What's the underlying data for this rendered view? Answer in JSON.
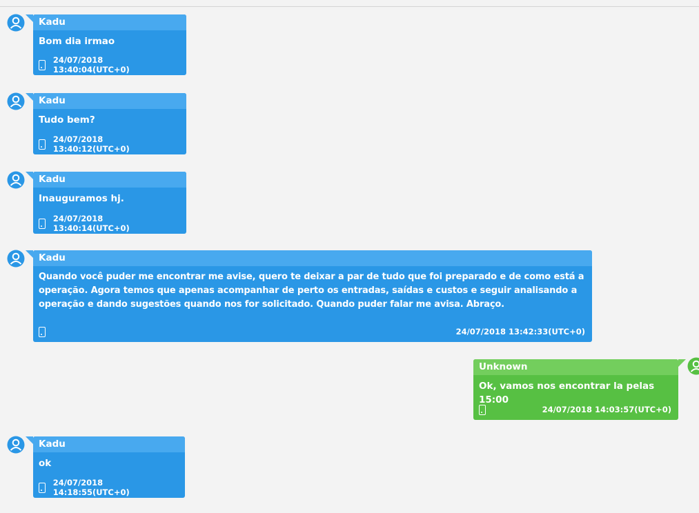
{
  "colors": {
    "incoming": "#2a97e6",
    "incoming_header": "#48a9ef",
    "outgoing": "#57c043",
    "outgoing_header": "#73ce5d",
    "avatar": "#2a97e6"
  },
  "messages": [
    {
      "sender": "Kadu",
      "text": "Bom dia irmao",
      "timestamp": "24/07/2018 13:40:04(UTC+0)",
      "direction": "incoming",
      "icon": "phone-icon"
    },
    {
      "sender": "Kadu",
      "text": "Tudo bem?",
      "timestamp": "24/07/2018 13:40:12(UTC+0)",
      "direction": "incoming",
      "icon": "phone-icon"
    },
    {
      "sender": "Kadu",
      "text": "Inauguramos hj.",
      "timestamp": "24/07/2018 13:40:14(UTC+0)",
      "direction": "incoming",
      "icon": "phone-icon"
    },
    {
      "sender": "Kadu",
      "text_lines": [
        "Quando você puder me encontrar me avise, quero te deixar a par de tudo que foi preparado e de como está a",
        "operação.  Agora temos que apenas acompanhar de perto os entradas, saídas e custos e seguir analisando a",
        "operação e dando sugestões quando nos for solicitado. Quando puder falar me avisa. Abraço."
      ],
      "timestamp": "24/07/2018 13:42:33(UTC+0)",
      "direction": "incoming",
      "icon": "phone-icon"
    },
    {
      "sender": "Unknown",
      "text": "Ok, vamos nos encontrar la pelas 15:00",
      "timestamp": "24/07/2018 14:03:57(UTC+0)",
      "direction": "outgoing",
      "icon": "phone-icon"
    },
    {
      "sender": "Kadu",
      "text": "ok",
      "timestamp": "24/07/2018 14:18:55(UTC+0)",
      "direction": "incoming",
      "icon": "phone-icon"
    }
  ]
}
